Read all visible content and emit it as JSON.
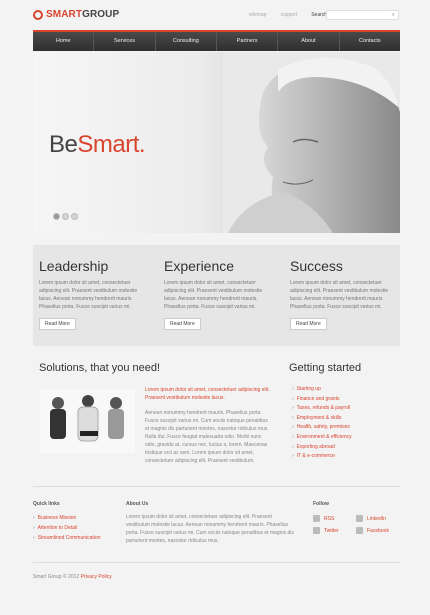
{
  "header": {
    "logo_smart": "SMART",
    "logo_group": "GROUP",
    "top_links": [
      "sitemap",
      "support",
      "Search"
    ],
    "search_placeholder": ""
  },
  "nav": {
    "items": [
      "Home",
      "Services",
      "Consulting",
      "Partners",
      "About",
      "Contacts"
    ]
  },
  "hero": {
    "title_plain": "Be",
    "title_accent": "Smart.",
    "dots_count": "3"
  },
  "features": [
    {
      "title": "Leadership",
      "text": "Lorem ipsum dolor sit amet, consectetuer adipiscing elit. Praesent vestibulum molestie lacus. Aenean nonummy hendrerit mauris. Phasellus porta. Fusce suscipit varius mi.",
      "button": "Read More"
    },
    {
      "title": "Experience",
      "text": "Lorem ipsum dolor sit amet, consectetuer adipiscing elit. Praesent vestibulum molestie lacus. Aenean nonummy hendrerit mauris. Phasellus porta. Fusce suscipit varius mi.",
      "button": "Read More"
    },
    {
      "title": "Success",
      "text": "Lorem ipsum dolor sit amet, consectetuer adipiscing elit. Praesent vestibulum molestie lacus. Aenean nonummy hendrerit mauris. Phasellus porta. Fusce suscipit varius mi.",
      "button": "Read More"
    }
  ],
  "solutions": {
    "title": "Solutions, that you need!",
    "lead": "Lorem ipsum dolor sit amet, consectetuer adipiscing elit. Praesent vestibulum molestie lacus.",
    "body": "Aenean nonummy hendrerit mauris. Phasellus porta. Fusce suscipit varius mi. Cum sociis natoque penatibus et magnis dis parturient montes, nascetur ridiculus mus. Nulla dui. Fusce feugiat malesuada odio. Morbi nunc odio, gravida at, cursus nec, luctus a, lorem. Maecenas tristique orci ac sem. Lorem ipsum dolor sit amet, consectetuer adipiscing elit. Praesent vestibulum."
  },
  "getting_started": {
    "title": "Getting started",
    "items": [
      "Starting up",
      "Finance and grants",
      "Taxes, refunds & payroll",
      "Employment & skills",
      "Health, safety, premises",
      "Environment & efficiency",
      "Exporting abroad",
      "IT & e-commerce"
    ]
  },
  "footer": {
    "quick_links_title": "Quick links",
    "quick_links": [
      "Business Mission",
      "Attention to Detail",
      "Streamlined Communication"
    ],
    "about_title": "About Us",
    "about_text": "Lorem ipsum dolor sit amet, consectetuer adipiscing elit. Praesent vestibulum molestie lacus. Aenean nonummy hendrerit mauris. Phasellus porta. Fusce suscipit varius mi. Cum sociis natoque penatibus et magnis dis parturient montes, nascetur ridiculus mus.",
    "follow_title": "Follow",
    "follow": [
      "RSS",
      "LinkedIn",
      "Twitter",
      "Facebook"
    ],
    "copyright": "Smart Group © 2012",
    "privacy": "Privacy Policy"
  },
  "colors": {
    "accent": "#d9442e",
    "nav_bg": "#3a3a3a"
  }
}
